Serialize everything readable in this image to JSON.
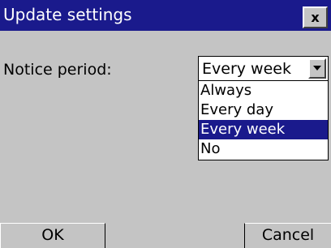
{
  "window": {
    "title": "Update settings",
    "close_label": "x"
  },
  "form": {
    "notice_label": "Notice period:",
    "selected_value": "Every week",
    "options": [
      "Always",
      "Every day",
      "Every week",
      "No"
    ],
    "selected_index": 2
  },
  "buttons": {
    "ok_label": "OK",
    "cancel_label": "Cancel"
  },
  "colors": {
    "titlebar": "#1a1a8c",
    "background": "#c4c4c4",
    "highlight": "#1a1a8c"
  }
}
